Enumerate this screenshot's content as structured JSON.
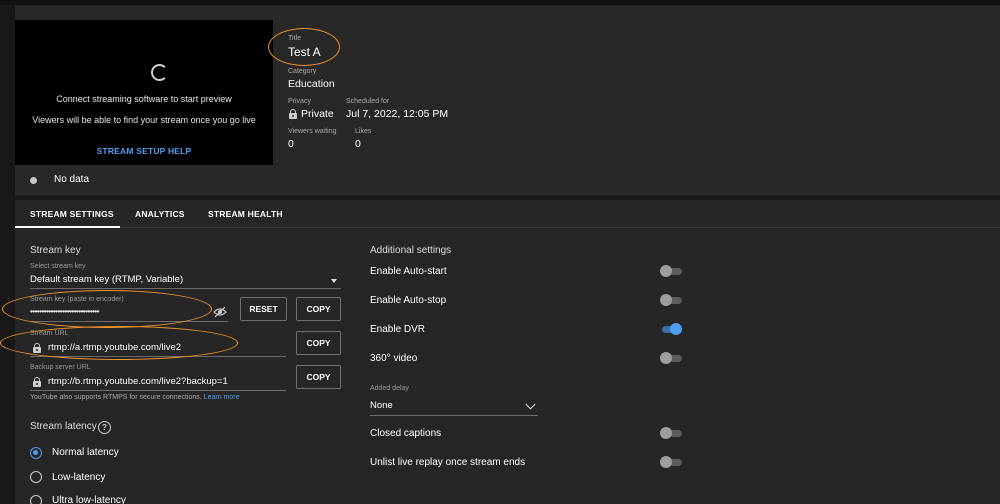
{
  "preview": {
    "line1": "Connect streaming software to start preview",
    "line2": "Viewers will be able to find your stream once you go live",
    "help_link": "STREAM SETUP HELP"
  },
  "details": {
    "title_label": "Title",
    "title_value": "Test A",
    "category_label": "Category",
    "category_value": "Education",
    "privacy_label": "Privacy",
    "privacy_value": "Private",
    "scheduled_label": "Scheduled for",
    "scheduled_value": "Jul 7, 2022, 12:05 PM",
    "viewers_label": "Viewers waiting",
    "viewers_value": "0",
    "likes_label": "Likes",
    "likes_value": "0"
  },
  "status": {
    "text": "No data"
  },
  "tabs": [
    {
      "label": "STREAM SETTINGS",
      "active": true
    },
    {
      "label": "ANALYTICS",
      "active": false
    },
    {
      "label": "STREAM HEALTH",
      "active": false
    }
  ],
  "stream_key": {
    "section_title": "Stream key",
    "select_label": "Select stream key",
    "select_value": "Default stream key (RTMP, Variable)",
    "key_label": "Stream key (paste in encoder)",
    "key_value": "••••••••••••••••••••••••••••••",
    "reset_label": "RESET",
    "copy_label": "COPY",
    "url_label": "Stream URL",
    "url_value": "rtmp://a.rtmp.youtube.com/live2",
    "backup_label": "Backup server URL",
    "backup_value": "rtmp://b.rtmp.youtube.com/live2?backup=1",
    "note_text": "YouTube also supports RTMPS for secure connections.",
    "note_link": "Learn more"
  },
  "latency": {
    "title": "Stream latency",
    "help_icon_glyph": "?",
    "options": [
      {
        "label": "Normal latency",
        "selected": true
      },
      {
        "label": "Low-latency",
        "selected": false
      },
      {
        "label": "Ultra low-latency",
        "selected": false
      }
    ]
  },
  "additional": {
    "title": "Additional settings",
    "settings": [
      {
        "label": "Enable Auto-start",
        "on": false
      },
      {
        "label": "Enable Auto-stop",
        "on": false
      },
      {
        "label": "Enable DVR",
        "on": true
      },
      {
        "label": "360° video",
        "on": false
      }
    ],
    "delay_label": "Added delay",
    "delay_value": "None",
    "closed_captions_label": "Closed captions",
    "closed_captions_on": false,
    "unlist_label": "Unlist live replay once stream ends",
    "unlist_on": false
  },
  "colors": {
    "accent_blue": "#4f9ff0",
    "annotation_orange": "#f0952a",
    "background": "#1f1f1f"
  }
}
